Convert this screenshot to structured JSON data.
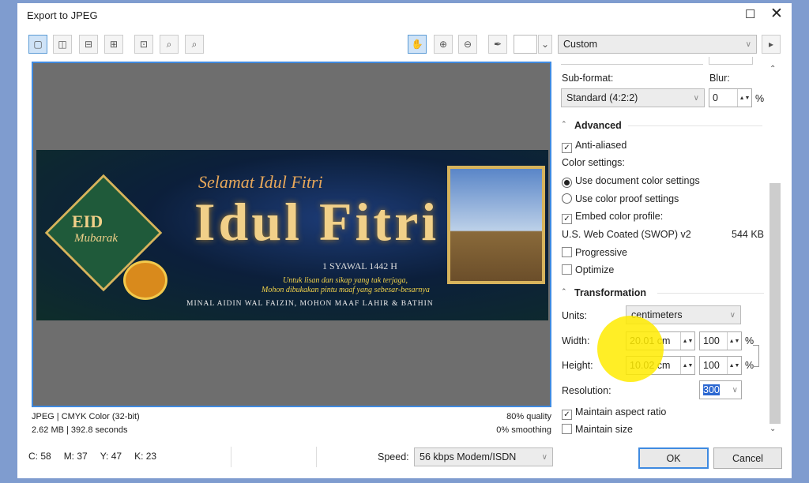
{
  "window": {
    "title": "Export to JPEG"
  },
  "toolbar": {
    "preset": "Custom"
  },
  "preview": {
    "banner": {
      "line1": "Selamat Idul Fitri",
      "title": "Idul Fitri",
      "date": "1 SYAWAL 1442 H",
      "msg1": "Untuk lisan dan sikap yang tak terjaga,",
      "msg2": "Mohon dibukakan pintu maaf yang sebesar-besarnya",
      "footer": "MINAL AIDIN WAL FAIZIN, MOHON MAAF LAHIR & BATHIN",
      "badge1": "EID",
      "badge2": "Mubarak"
    }
  },
  "status": {
    "format": "JPEG | CMYK Color (32-bit)",
    "size": "2.62 MB | 392.8 seconds",
    "quality": "80% quality",
    "smoothing": "0% smoothing"
  },
  "color_readout": {
    "c": "C: 58",
    "m": "M: 37",
    "y": "Y: 47",
    "k": "K: 23"
  },
  "speed": {
    "label": "Speed:",
    "value": "56 kbps Modem/ISDN"
  },
  "panel": {
    "subformat_label": "Sub-format:",
    "subformat": "Standard (4:2:2)",
    "blur_label": "Blur:",
    "blur": "0",
    "pct": "%",
    "advanced": "Advanced",
    "anti_aliased": "Anti-aliased",
    "color_settings": "Color settings:",
    "use_doc": "Use document color settings",
    "use_proof": "Use color proof settings",
    "embed": "Embed color profile:",
    "profile": "U.S. Web Coated (SWOP) v2",
    "profile_size": "544 KB",
    "progressive": "Progressive",
    "optimize": "Optimize",
    "transformation": "Transformation",
    "units_label": "Units:",
    "units": "centimeters",
    "width_label": "Width:",
    "width": "20.01 cm",
    "width_pct": "100",
    "height_label": "Height:",
    "height": "10.02 cm",
    "height_pct": "100",
    "resolution_label": "Resolution:",
    "resolution": "300",
    "aspect": "Maintain aspect ratio",
    "size": "Maintain size"
  },
  "buttons": {
    "ok": "OK",
    "cancel": "Cancel"
  }
}
